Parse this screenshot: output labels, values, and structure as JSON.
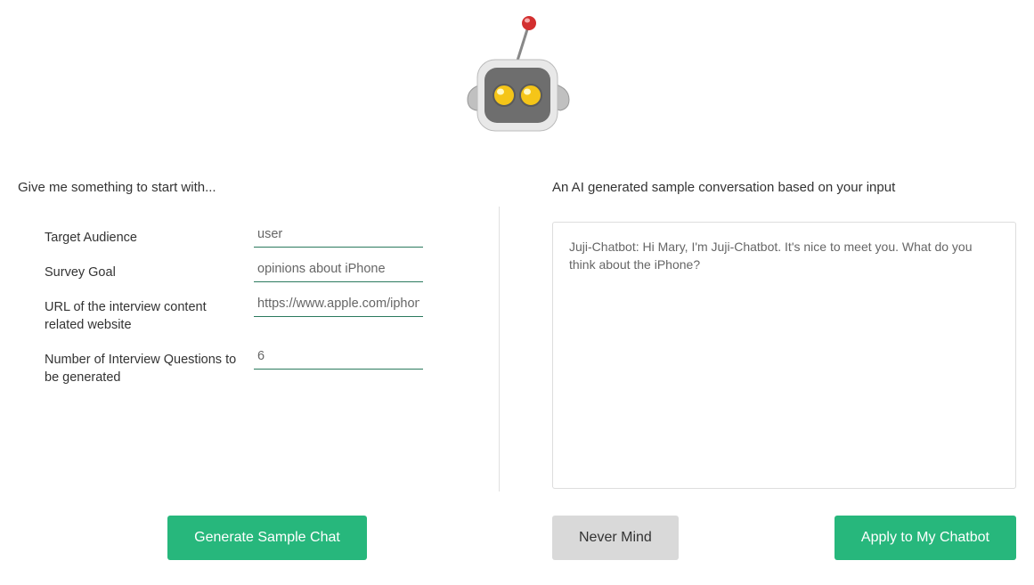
{
  "left": {
    "title": "Give me something to start with...",
    "fields": {
      "target_audience": {
        "label": "Target Audience",
        "value": "user"
      },
      "survey_goal": {
        "label": "Survey Goal",
        "value": "opinions about iPhone"
      },
      "url": {
        "label": "URL of the interview content related website",
        "value": "https://www.apple.com/iphone/"
      },
      "num_questions": {
        "label": "Number of Interview Questions to be generated",
        "value": "6"
      }
    }
  },
  "right": {
    "title": "An AI generated sample conversation based on your input",
    "conversation": "Juji-Chatbot: Hi Mary, I'm Juji-Chatbot. It's nice to meet you. What do you think about the iPhone?"
  },
  "buttons": {
    "generate": "Generate Sample Chat",
    "never_mind": "Never Mind",
    "apply": "Apply to My Chatbot"
  }
}
